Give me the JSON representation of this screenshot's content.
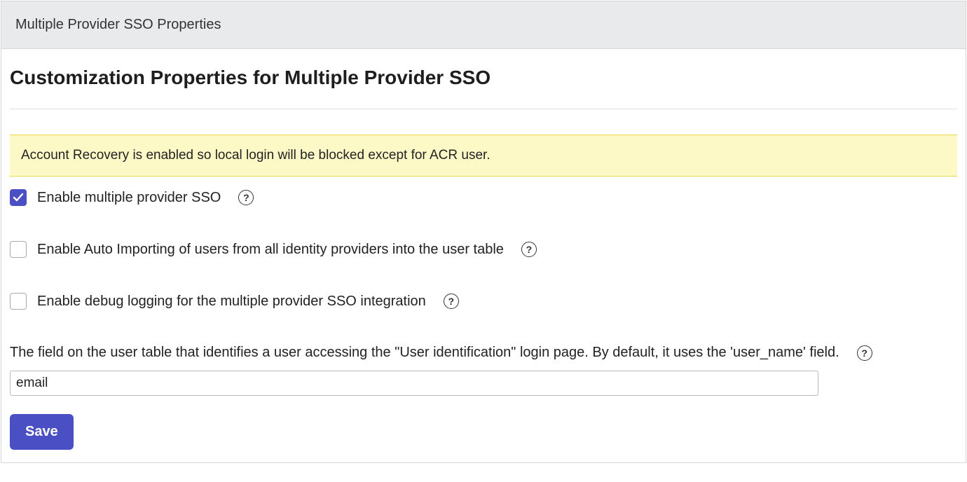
{
  "header": {
    "title": "Multiple Provider SSO Properties"
  },
  "page": {
    "title": "Customization Properties for Multiple Provider SSO"
  },
  "alert": {
    "message": "Account Recovery is enabled so local login will be blocked except for ACR user."
  },
  "fields": {
    "enable_sso": {
      "label": "Enable multiple provider SSO",
      "checked": true
    },
    "auto_import": {
      "label": "Enable Auto Importing of users from all identity providers into the user table",
      "checked": false
    },
    "debug_log": {
      "label": "Enable debug logging for the multiple provider SSO integration",
      "checked": false
    },
    "user_id_field": {
      "label": "The field on the user table that identifies a user accessing the \"User identification\" login page. By default, it uses the 'user_name' field.",
      "value": "email"
    }
  },
  "actions": {
    "save": "Save"
  }
}
